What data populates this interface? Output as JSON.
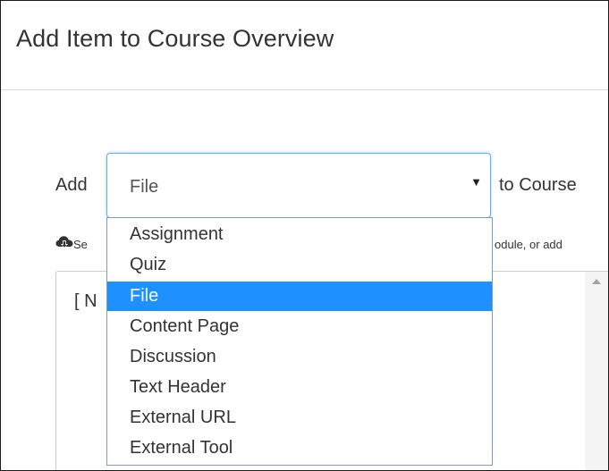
{
  "modal": {
    "title": "Add Item to Course Overview"
  },
  "form": {
    "add_label": "Add",
    "selected_type": "File",
    "to_label": "to Course",
    "help_text_left": "Se",
    "help_text_right": "odule, or add",
    "list_first_item": "[ N"
  },
  "dropdown": {
    "options": [
      "Assignment",
      "Quiz",
      "File",
      "Content Page",
      "Discussion",
      "Text Header",
      "External URL",
      "External Tool"
    ],
    "selected_index": 2
  },
  "colors": {
    "highlight": "#1e90ff",
    "focus_border": "#66afe9",
    "text": "#333333"
  }
}
